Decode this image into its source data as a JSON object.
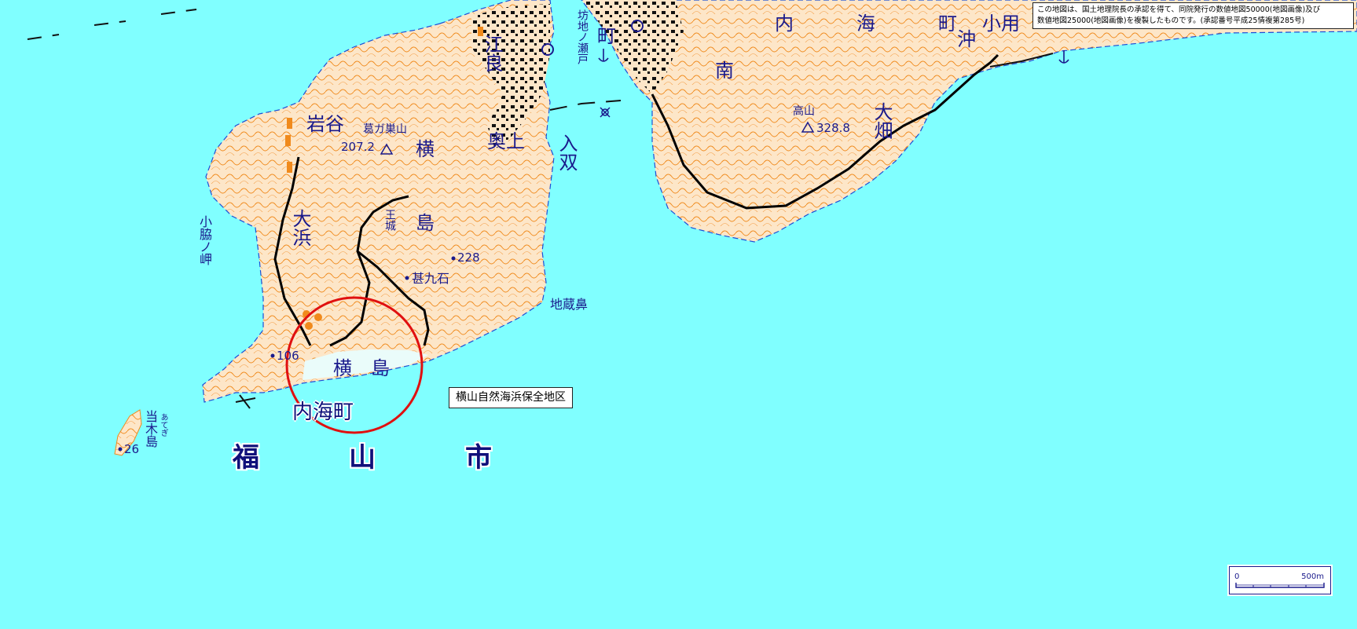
{
  "credit": {
    "line1": "この地図は、国土地理院長の承認を得て、同院発行の数値地図50000(地図画像)及び",
    "line2": "数値地図25000(地図画像)を複製したものです。(承認番号平成25情複第285号)"
  },
  "reserve_label": "横山自然海浜保全地区",
  "scale_bar": {
    "zero": "0",
    "max": "500m"
  },
  "places": {
    "city": "福　山　市",
    "town_bottom": "内海町",
    "town_top": "内　海　町",
    "island_yoko": "横",
    "island_shima": "島",
    "beach_yokoshima": "横　島",
    "iwatani": "岩谷",
    "ohama": "大浜",
    "ryo": "江良",
    "okugami": "奥上",
    "irifuta": "入双",
    "minami": "南",
    "ohata": "大畑",
    "oki": "沖",
    "koyo": "小用",
    "machi": "町",
    "kowakinomisaki": "小脇ノ岬",
    "jizobana": "地蔵鼻",
    "jinkuishi": "甚九石",
    "kuzugasuyama": "葛ガ巣山",
    "oshiro": "王城",
    "bochinoseto": "坊地ノ瀬戸",
    "takayama": "高山",
    "ategishima": "当木島",
    "ategi_furigana": "あてぎ"
  },
  "heights": {
    "kuzugasu": "207.2",
    "takayama": "328.8",
    "p228": "228",
    "p106": "106",
    "p26": "26"
  },
  "colors": {
    "sea": "#80ffff",
    "land": "#fde6c8",
    "contour": "#f08a1c",
    "shore_dash": "#1a4fd6",
    "road": "#000000",
    "label": "#1a1a8c",
    "circle": "#e01010"
  }
}
